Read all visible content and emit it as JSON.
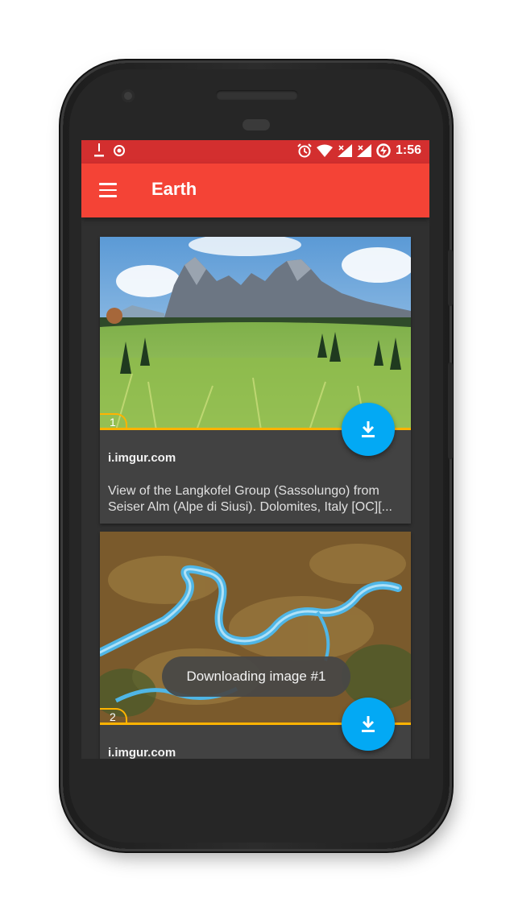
{
  "status_bar": {
    "time": "1:56",
    "left_icons": [
      "download-icon",
      "record-icon"
    ],
    "right_icons": [
      "alarm-icon",
      "wifi-icon",
      "signal-icon",
      "signal-icon",
      "battery-charging-icon"
    ]
  },
  "app_bar": {
    "title": "Earth",
    "menu_icon": "hamburger-menu-icon",
    "color": "#f44336",
    "status_color": "#d32f2f"
  },
  "posts": [
    {
      "number": "1",
      "source": "i.imgur.com",
      "description": "View of the Langkofel Group (Sassolungo) from Seiser Alm (Alpe di Siusi). Dolomites, Italy [OC][...",
      "image_subject": "mountain meadow landscape",
      "action_icon": "download-icon"
    },
    {
      "number": "2",
      "source": "i.imgur.com",
      "description": "",
      "image_subject": "aerial river landscape",
      "action_icon": "download-icon"
    }
  ],
  "toast": {
    "message": "Downloading image #1"
  },
  "accent": "#03a9f4",
  "badge_color": "#ffb300"
}
